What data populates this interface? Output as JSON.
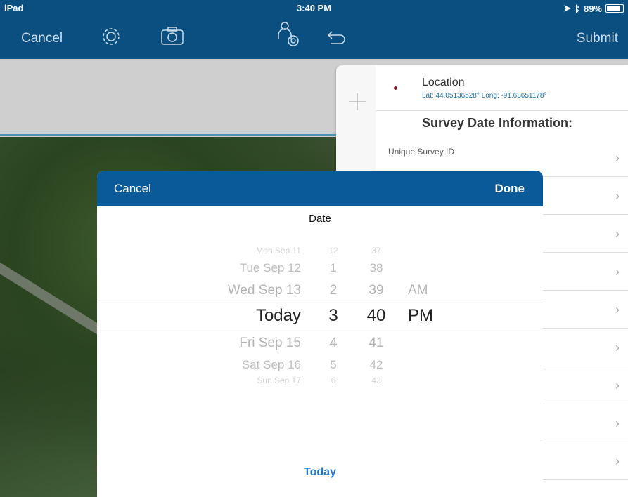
{
  "status_bar": {
    "device": "iPad",
    "time": "3:40 PM",
    "battery": "89%"
  },
  "nav": {
    "cancel": "Cancel",
    "submit": "Submit",
    "icons": [
      "gear-icon",
      "camera-icon",
      "sketch-person-icon",
      "undo-icon"
    ]
  },
  "side_panel": {
    "location_title": "Location",
    "location_coords": "Lat: 44.05136528° Long: -91.63651178°",
    "section_title": "Survey Date Information:",
    "rows": [
      {
        "label": "Unique Survey ID"
      },
      {
        "label": ""
      },
      {
        "label": ""
      },
      {
        "label": ""
      },
      {
        "label": ""
      },
      {
        "label": ""
      },
      {
        "label": ""
      },
      {
        "label": ""
      },
      {
        "label": ""
      }
    ]
  },
  "picker_modal": {
    "cancel": "Cancel",
    "done": "Done",
    "title": "Date",
    "today_button": "Today",
    "days": [
      "Mon Sep 11",
      "Tue Sep 12",
      "Wed Sep 13",
      "Today",
      "Fri Sep 15",
      "Sat Sep 16",
      "Sun Sep 17"
    ],
    "hours": [
      "12",
      "1",
      "2",
      "3",
      "4",
      "5",
      "6"
    ],
    "minutes": [
      "37",
      "38",
      "39",
      "40",
      "41",
      "42",
      "43"
    ],
    "ampm": [
      "AM",
      "PM"
    ],
    "selected": {
      "day": "Today",
      "hour": "3",
      "minute": "40",
      "ampm": "PM"
    }
  }
}
